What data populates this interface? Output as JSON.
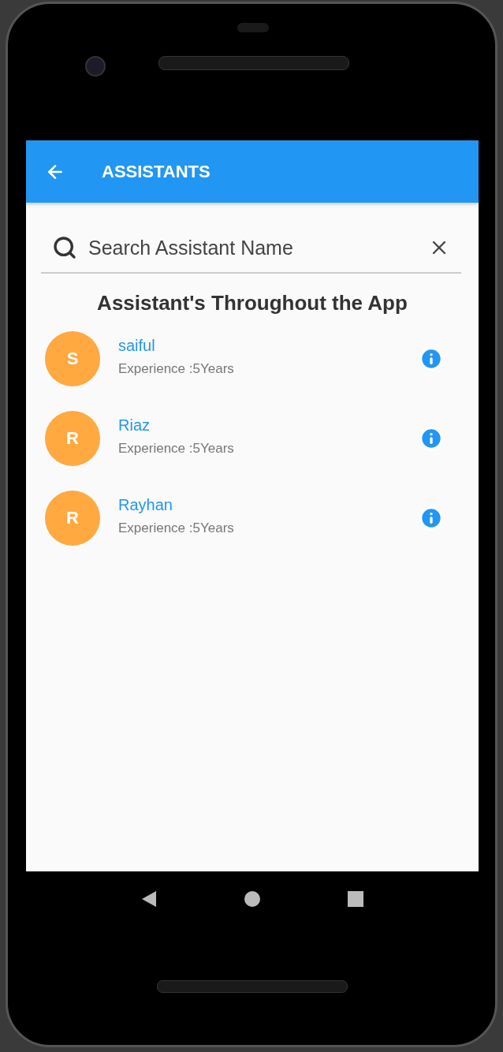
{
  "app_bar": {
    "title": "ASSISTANTS"
  },
  "search": {
    "placeholder": "Search Assistant Name"
  },
  "heading": "Assistant's Throughout the App",
  "assistants": [
    {
      "initial": "S",
      "name": "saiful",
      "experience": "Experience :5Years"
    },
    {
      "initial": "R",
      "name": "Riaz",
      "experience": "Experience :5Years"
    },
    {
      "initial": "R",
      "name": "Rayhan",
      "experience": "Experience :5Years"
    }
  ]
}
